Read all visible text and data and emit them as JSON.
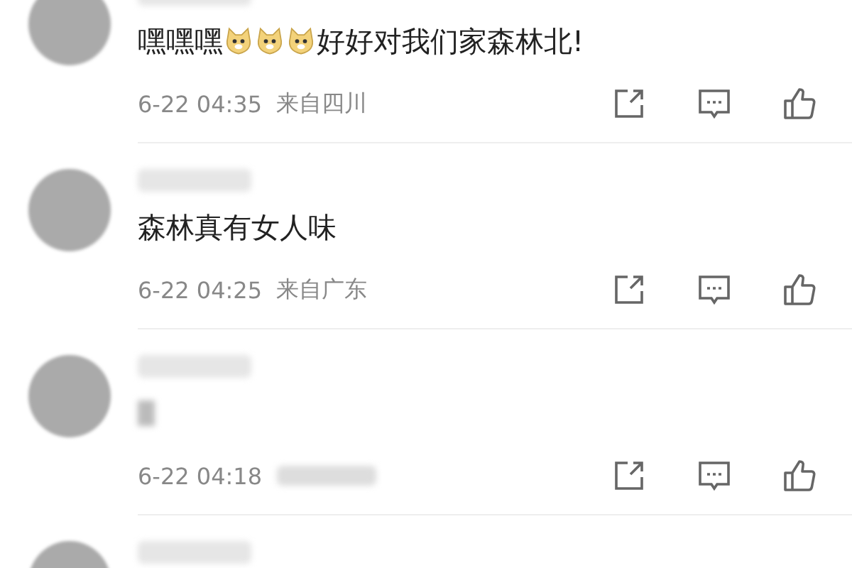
{
  "comments": [
    {
      "content": [
        {
          "kind": "text",
          "text": "嘿嘿嘿"
        },
        {
          "kind": "emoji"
        },
        {
          "kind": "emoji"
        },
        {
          "kind": "emoji"
        },
        {
          "kind": "text",
          "text": "好好对我们家森林北!"
        }
      ],
      "time": "6-22 04:35",
      "location": "来自四川"
    },
    {
      "content": [
        {
          "kind": "text",
          "text": "森林真有女人味"
        }
      ],
      "time": "6-22 04:25",
      "location": "来自广东"
    },
    {
      "time": "6-22 04:18"
    }
  ]
}
